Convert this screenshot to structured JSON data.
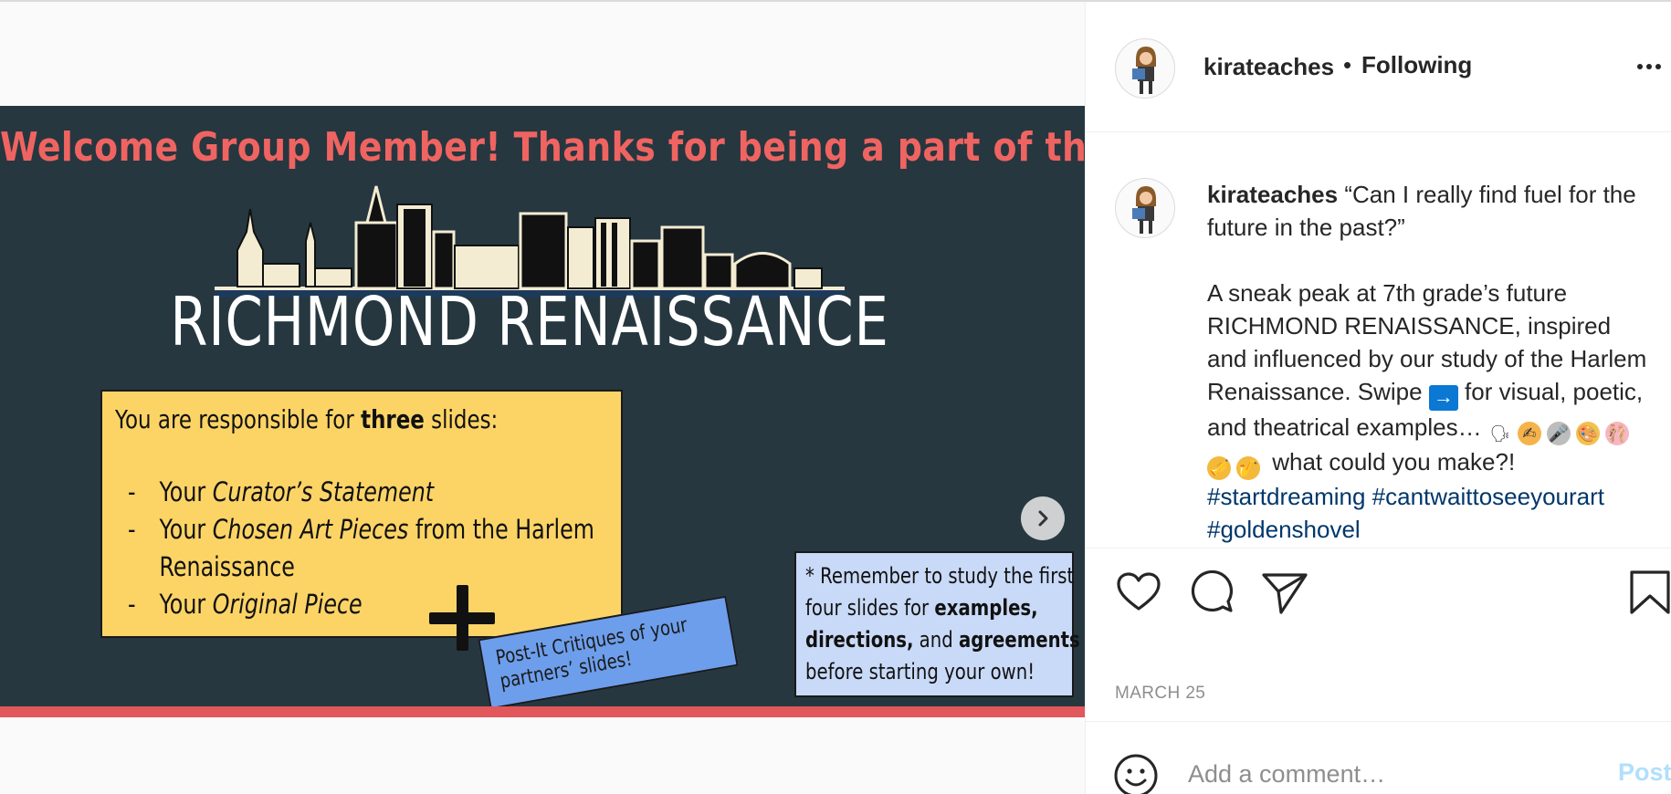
{
  "post": {
    "slide": {
      "welcome": "Welcome Group Member! Thanks for being a part of the",
      "title": "RICHMOND RENAISSANCE",
      "box_head_pre": "You are responsible for ",
      "box_head_bold": "three",
      "box_head_post": " slides:",
      "items": [
        {
          "dash": "-",
          "pre": "Your ",
          "italic": "Curator’s Statement",
          "post": ""
        },
        {
          "dash": "-",
          "pre": "Your ",
          "italic": "Chosen Art Pieces",
          "post": " from the Harlem"
        },
        {
          "dash": "",
          "pre": "Renaissance",
          "italic": "",
          "post": ""
        },
        {
          "dash": "-",
          "pre": "Your ",
          "italic": "Original Piece",
          "post": ""
        }
      ],
      "postit_line1": "Post-It Critiques of your",
      "postit_line2": "partners’ slides!",
      "reminder": {
        "l1": "* Remember to study the first",
        "l2_pre": "four slides for ",
        "l2_bold": "examples,",
        "l3_bold1": "directions,",
        "l3_mid": " and ",
        "l3_bold2": "agreements",
        "l4": "before starting your own!"
      },
      "dot_count": 8,
      "active_dot": 0
    }
  },
  "header": {
    "username": "kirateaches",
    "separator": "•",
    "follow_status": "Following"
  },
  "caption": {
    "username": "kirateaches",
    "quote": "“Can I really find fuel for the future in the past?”",
    "body_1": "A sneak peak at 7th grade’s future RICHMOND RENAISSANCE, inspired and influenced by our study of the Harlem Renaissance. Swipe",
    "arrow_emoji": "→",
    "body_2": "for visual, poetic, and theatrical examples…",
    "emojis": [
      "🗣",
      "✍",
      "🎤",
      "🎨",
      "🩰",
      "🎺",
      "🎷"
    ],
    "body_3": "what could you make?!",
    "hashtags": [
      "#startdreaming",
      "#cantwaittoseeyourart",
      "#goldenshovel"
    ]
  },
  "actions": {
    "icons": [
      "heart-icon",
      "comment-icon",
      "share-icon",
      "bookmark-icon"
    ],
    "date": "MARCH 25"
  },
  "comment_box": {
    "placeholder": "Add a comment…",
    "post_label": "Post"
  },
  "colors": {
    "slide_bg": "#263740",
    "welcome_red": "#ef6461",
    "yellow": "#fcd466",
    "postit_blue": "#6d9eeb",
    "reminder_blue": "#c9daf8",
    "hashtag": "#00376b",
    "post_disabled": "#b2dffc"
  }
}
